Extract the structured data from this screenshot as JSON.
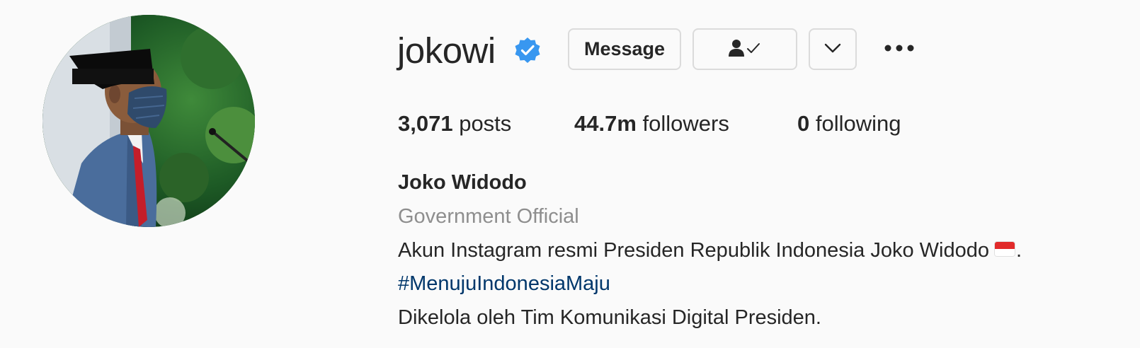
{
  "profile": {
    "username": "jokowi",
    "verified_icon": "verified-badge-icon",
    "accent_color": "#3897f0"
  },
  "actions": {
    "message_label": "Message",
    "following_icon": "person-check-icon",
    "dropdown_icon": "chevron-down-icon",
    "more_icon": "more-options-icon"
  },
  "stats": {
    "posts_count": "3,071",
    "posts_label": "posts",
    "followers_count": "44.7m",
    "followers_label": "followers",
    "following_count": "0",
    "following_label": "following"
  },
  "bio": {
    "full_name": "Joko Widodo",
    "category": "Government Official",
    "line1": "Akun Instagram resmi Presiden Republik Indonesia Joko Widodo",
    "line1_end": ".",
    "flag_icon": "indonesia-flag-icon",
    "hashtag": "#MenujuIndonesiaMaju",
    "hashtag_color": "#00376b",
    "line3": "Dikelola oleh Tim Komunikasi Digital Presiden."
  }
}
